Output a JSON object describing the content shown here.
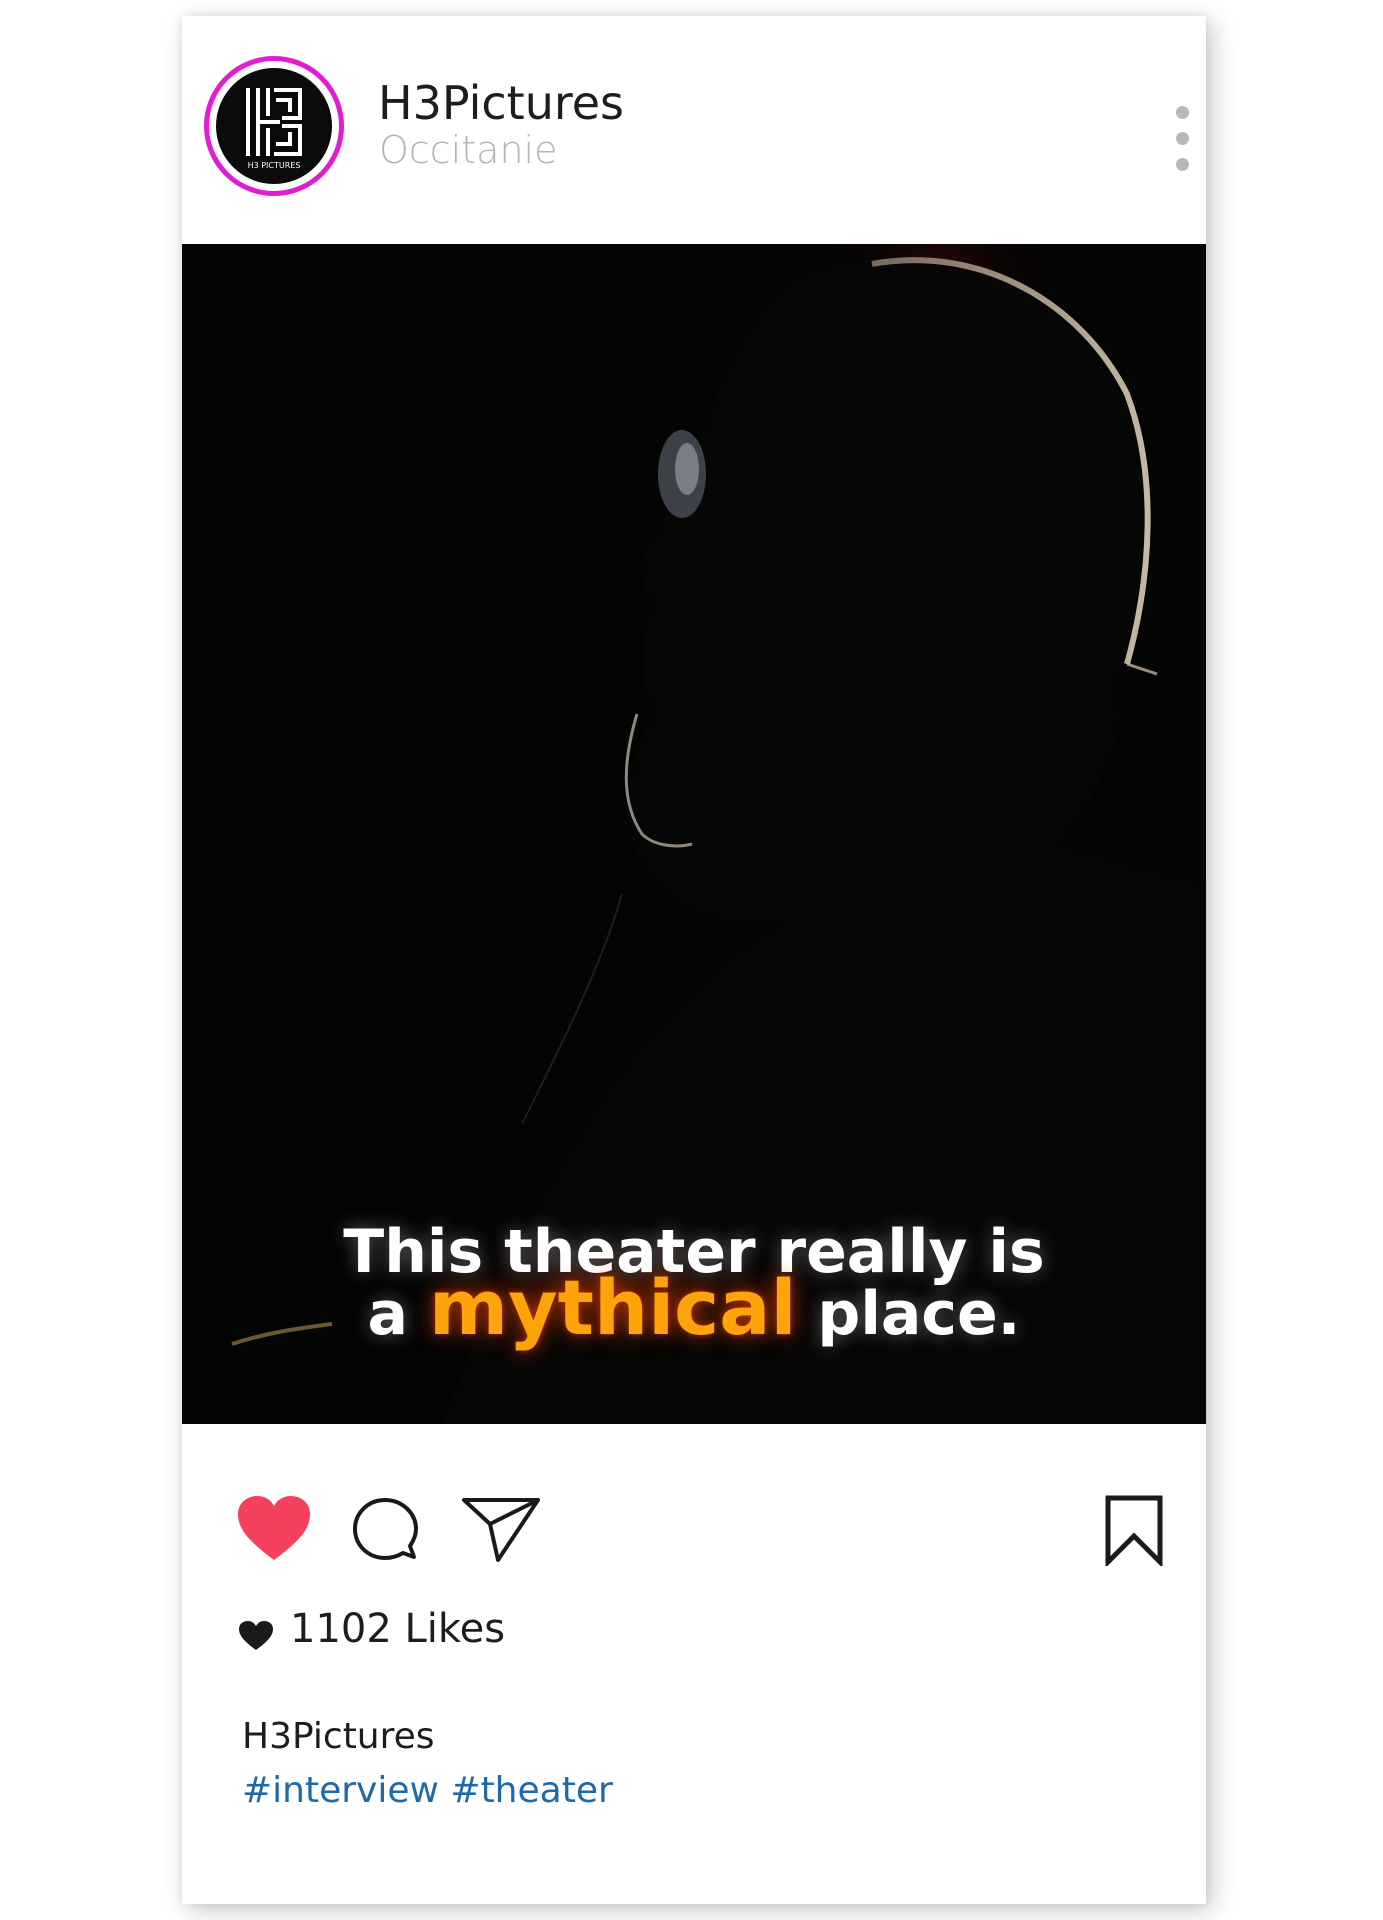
{
  "post": {
    "username": "H3Pictures",
    "location": "Occitanie",
    "avatar_logo_text": "H3 PICTURES",
    "more_icon": "more-vertical-icon"
  },
  "media": {
    "caption_line1": "This theater really is",
    "caption_line2_prefix": "a",
    "caption_line2_accent": "mythical",
    "caption_line2_suffix": "place.",
    "accent_color": "#ffa30a"
  },
  "actions": {
    "like_icon": "heart-filled-icon",
    "comment_icon": "comment-icon",
    "share_icon": "send-icon",
    "save_icon": "bookmark-icon",
    "like_color": "#f4415d"
  },
  "stats": {
    "likes_text": "1102 Likes"
  },
  "caption": {
    "username": "H3Pictures",
    "hashtags": [
      "#interview",
      "#theater"
    ]
  }
}
